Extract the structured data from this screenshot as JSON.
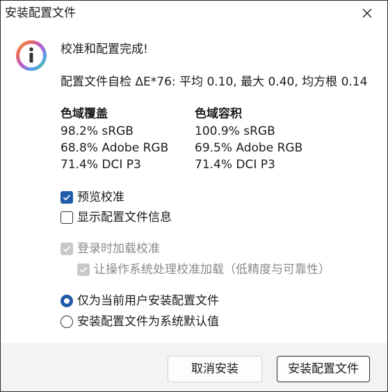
{
  "window": {
    "title": "安装配置文件"
  },
  "content": {
    "headline": "校准和配置完成!",
    "selfcheck": "配置文件自检 ΔE*76: 平均 0.10, 最大 0.40, 均方根 0.14",
    "coverage": {
      "heading": "色域覆盖",
      "rows": [
        "98.2% sRGB",
        "68.8% Adobe RGB",
        "71.4% DCI P3"
      ]
    },
    "volume": {
      "heading": "色域容积",
      "rows": [
        "100.9% sRGB",
        "69.5% Adobe RGB",
        "71.4% DCI P3"
      ]
    }
  },
  "options": {
    "preview": {
      "label": "预览校准",
      "checked": true
    },
    "show_info": {
      "label": "显示配置文件信息",
      "checked": false
    },
    "load_login": {
      "label": "登录时加载校准",
      "checked": true,
      "disabled": true
    },
    "os_handle": {
      "label": "让操作系统处理校准加载（低精度与可靠性）",
      "checked": true,
      "disabled": true
    }
  },
  "install_scope": {
    "current_user": {
      "label": "仅为当前用户安装配置文件",
      "selected": true
    },
    "system_default": {
      "label": "安装配置文件为系统默认值",
      "selected": false
    }
  },
  "buttons": {
    "cancel": "取消安装",
    "install": "安装配置文件"
  },
  "colors": {
    "accent": "#1f5ba8",
    "disabled": "#c8c8c8",
    "disabled_text": "#8a8a8a",
    "footer_bg": "#f3f3f3"
  }
}
